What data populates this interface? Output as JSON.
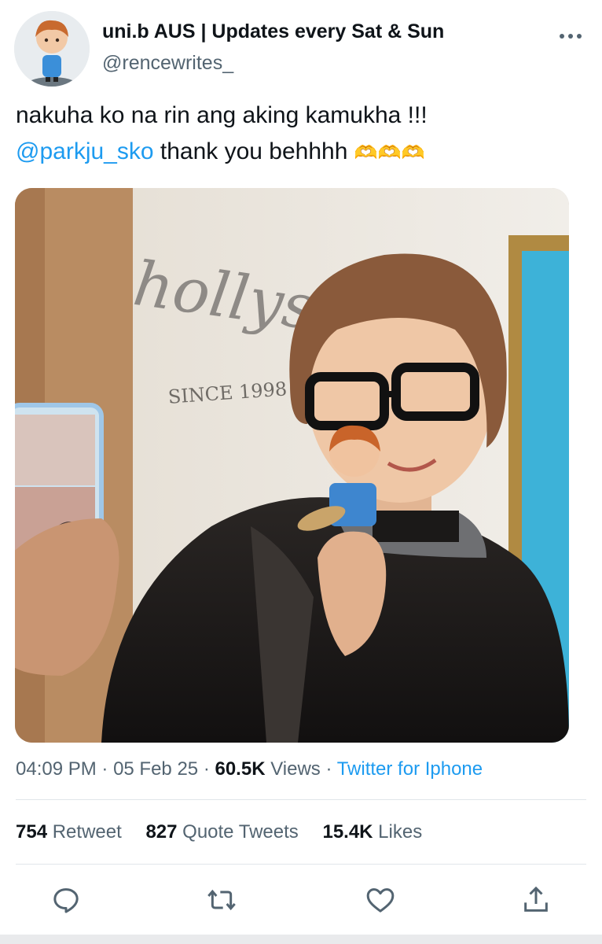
{
  "author": {
    "display_name": "uni.b AUS | Updates every Sat & Sun",
    "handle": "@rencewrites_",
    "avatar_icon": "figurine-avatar"
  },
  "tweet": {
    "line1": "nakuha ko na rin ang aking kamukha !!!",
    "mention": "@parkju_sko",
    "line2_rest": " thank you behhhh ",
    "emoji": "🫶🫶🫶",
    "media_sign_text": "hollys",
    "media_sign_sub": "SINCE 1998"
  },
  "meta": {
    "time": "04:09 PM",
    "sep1": " · ",
    "date": "05 Feb 25",
    "sep2": " · ",
    "views_count": "60.5K",
    "views_label": " Views",
    "sep3": " · ",
    "source": "Twitter for Iphone"
  },
  "stats": {
    "retweets_count": "754",
    "retweets_label": " Retweet",
    "quotes_count": "827",
    "quotes_label": " Quote Tweets",
    "likes_count": "15.4K",
    "likes_label": " Likes"
  },
  "actions": [
    "reply-icon",
    "retweet-icon",
    "like-icon",
    "share-icon"
  ],
  "colors": {
    "accent": "#1d9bf0",
    "secondary_text": "#536471",
    "primary_text": "#0f1419"
  }
}
